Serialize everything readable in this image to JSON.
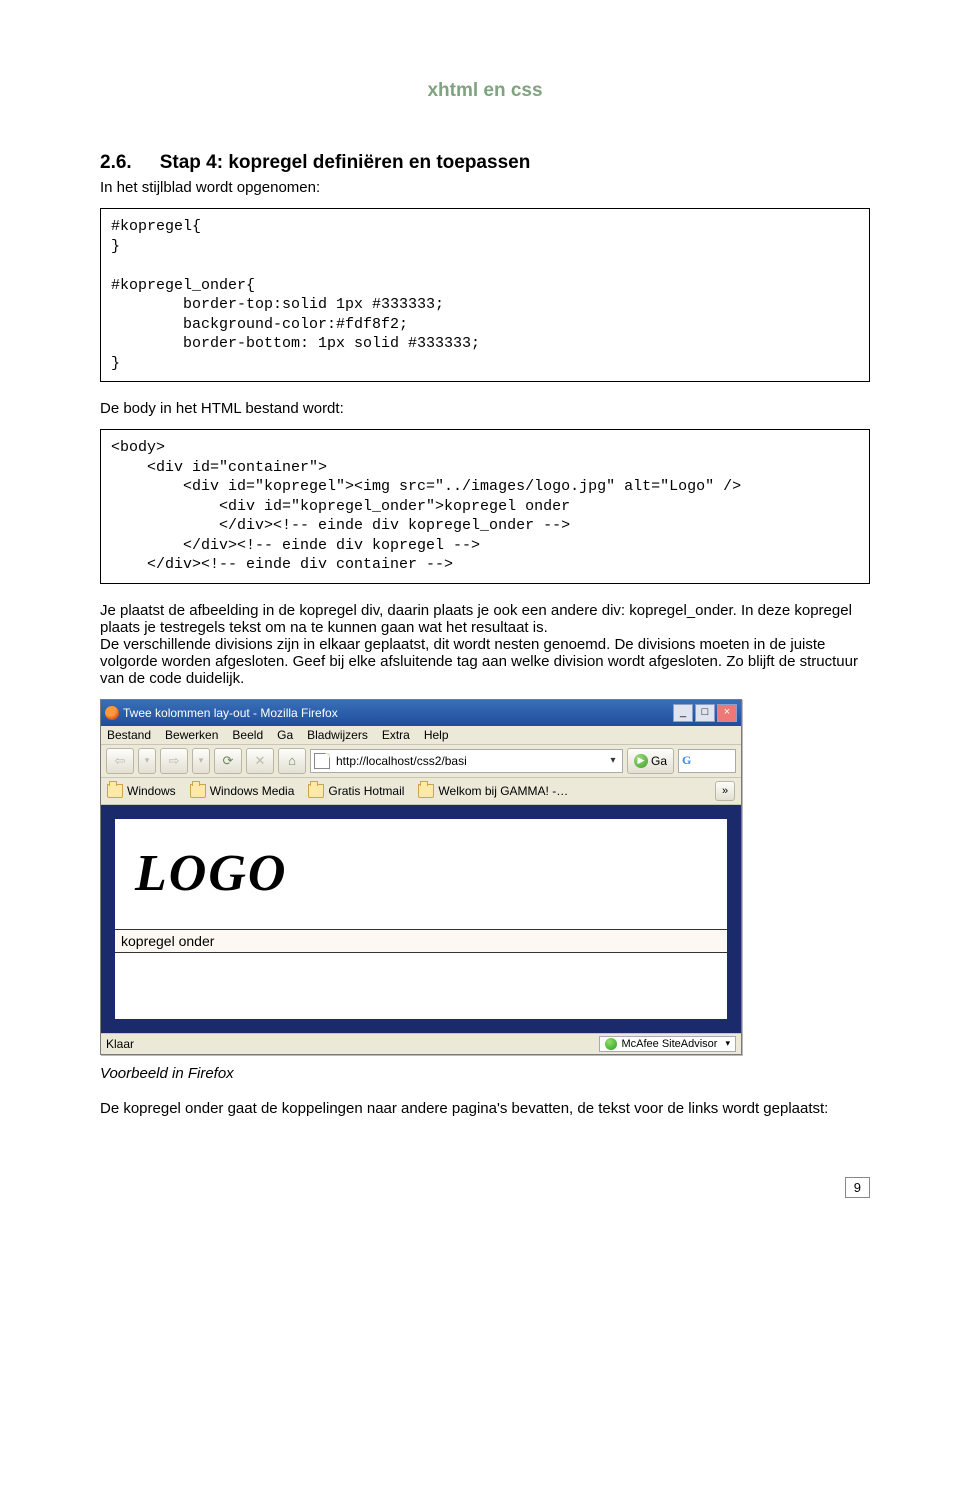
{
  "header": {
    "title": "xhtml en css"
  },
  "section": {
    "number": "2.6.",
    "title": "Stap 4: kopregel definiëren en toepassen",
    "intro": "In het stijlblad wordt opgenomen:"
  },
  "code1": "#kopregel{\n}\n\n#kopregel_onder{\n        border-top:solid 1px #333333;\n        background-color:#fdf8f2;\n        border-bottom: 1px solid #333333;\n}",
  "mid_para": "De body in het HTML bestand wordt:",
  "code2": "<body>\n    <div id=\"container\">\n        <div id=\"kopregel\"><img src=\"../images/logo.jpg\" alt=\"Logo\" />\n            <div id=\"kopregel_onder\">kopregel onder\n            </div><!-- einde div kopregel_onder -->\n        </div><!-- einde div kopregel -->\n    </div><!-- einde div container -->",
  "explain": "Je plaatst de afbeelding in de kopregel div, daarin plaats je ook een andere div: kopregel_onder. In deze kopregel plaats je testregels tekst om na te kunnen gaan wat het resultaat is.\nDe verschillende divisions zijn in elkaar geplaatst, dit wordt nesten genoemd. De divisions moeten in de juiste volgorde worden afgesloten. Geef bij elke afsluitende tag aan welke division wordt afgesloten. Zo blijft de structuur van de code duidelijk.",
  "browser": {
    "title": "Twee kolommen lay-out - Mozilla Firefox",
    "menus": [
      "Bestand",
      "Bewerken",
      "Beeld",
      "Ga",
      "Bladwijzers",
      "Extra",
      "Help"
    ],
    "url": "http://localhost/css2/basi",
    "go": "Ga",
    "bookmarks": [
      "Windows",
      "Windows Media",
      "Gratis Hotmail",
      "Welkom bij GAMMA! -…"
    ],
    "logo_text": "LOGO",
    "kopregel_onder": "kopregel onder",
    "status": "Klaar",
    "siteadvisor": "McAfee SiteAdvisor"
  },
  "caption": "Voorbeeld in Firefox",
  "final_para": "De kopregel onder gaat de koppelingen naar andere pagina's bevatten, de tekst voor de links wordt geplaatst:",
  "page_number": "9"
}
